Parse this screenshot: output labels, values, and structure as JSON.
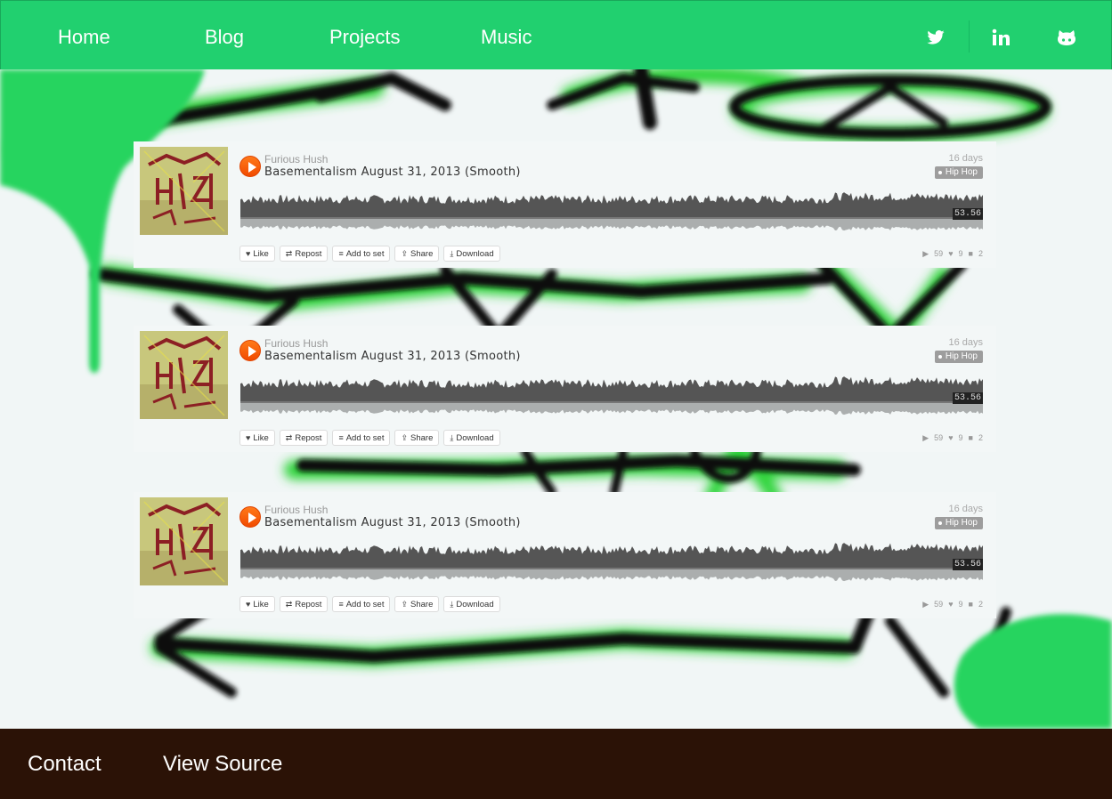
{
  "nav": {
    "links": [
      "Home",
      "Blog",
      "Projects",
      "Music"
    ],
    "social": [
      "twitter-icon",
      "linkedin-icon",
      "github-icon"
    ]
  },
  "tracks": [
    {
      "artist": "Furious Hush",
      "title": "Basementalism August 31, 2013 (Smooth)",
      "date": "16 days",
      "tag": "Hip Hop",
      "duration": "53.56",
      "actions": [
        "Like",
        "Repost",
        "Add to set",
        "Share",
        "Download"
      ],
      "plays": "59",
      "likes": "9",
      "comments": "2"
    },
    {
      "artist": "Furious Hush",
      "title": "Basementalism August 31, 2013 (Smooth)",
      "date": "16 days",
      "tag": "Hip Hop",
      "duration": "53.56",
      "actions": [
        "Like",
        "Repost",
        "Add to set",
        "Share",
        "Download"
      ],
      "plays": "59",
      "likes": "9",
      "comments": "2"
    },
    {
      "artist": "Furious Hush",
      "title": "Basementalism August 31, 2013 (Smooth)",
      "date": "16 days",
      "tag": "Hip Hop",
      "duration": "53.56",
      "actions": [
        "Like",
        "Repost",
        "Add to set",
        "Share",
        "Download"
      ],
      "plays": "59",
      "likes": "9",
      "comments": "2"
    }
  ],
  "footer": {
    "contact": "Contact",
    "source": "View Source"
  },
  "colors": {
    "nav_bg": "#21d06f",
    "footer_bg": "#2b1206",
    "play_orange": "#f14a00"
  }
}
